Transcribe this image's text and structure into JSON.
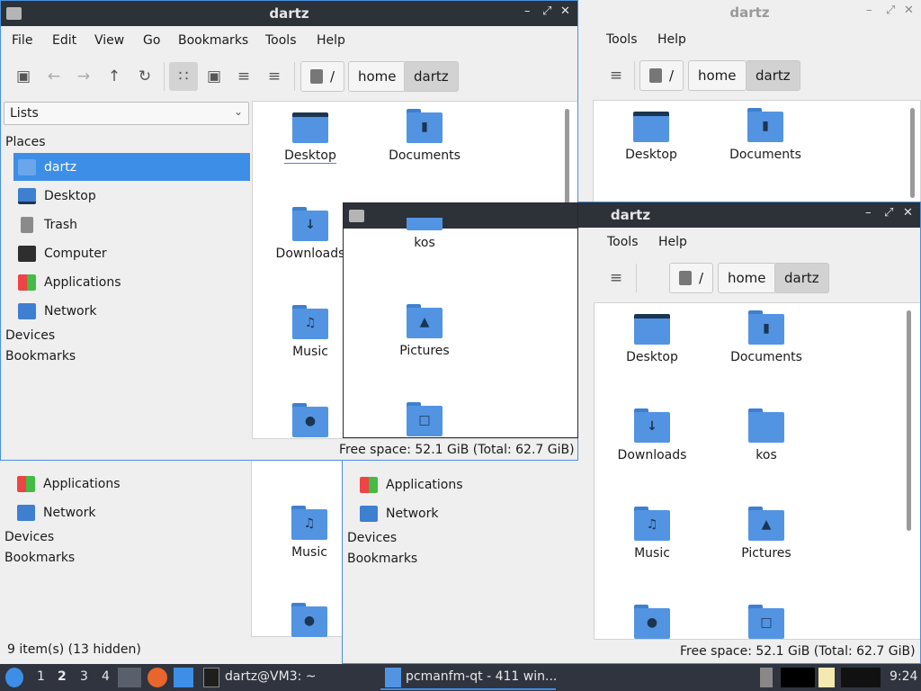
{
  "windows": {
    "title": "dartz",
    "menu": [
      "File",
      "Edit",
      "View",
      "Go",
      "Bookmarks",
      "Tools",
      "Help"
    ],
    "menu_tools": "Tools",
    "menu_help": "Help",
    "breadcrumb": {
      "root": "/",
      "home": "home",
      "current": "dartz"
    },
    "view_mode": "Lists",
    "places_header": "Places",
    "places": [
      "dartz",
      "Desktop",
      "Trash",
      "Computer",
      "Applications",
      "Network"
    ],
    "devices_header": "Devices",
    "bookmarks_header": "Bookmarks",
    "files": [
      "Desktop",
      "Documents",
      "Downloads",
      "kos",
      "Music",
      "Pictures"
    ],
    "free_space": "Free space: 52.1 GiB (Total: 62.7 GiB)",
    "item_count": "9 item(s) (13 hidden)",
    "controls": {
      "minimize": "–",
      "maximize": "⤢",
      "close": "✕"
    }
  },
  "taskbar": {
    "workspaces": [
      "1",
      "2",
      "3",
      "4"
    ],
    "active_workspace": "2",
    "terminal": "dartz@VM3: ~",
    "pcmanfm": "pcmanfm-qt - 411 win...",
    "clock": "9:24"
  },
  "colors": {
    "accent": "#3d8ee6",
    "folder": "#5294e2",
    "titlebar": "#2d3138",
    "taskbar": "#2f343f"
  }
}
